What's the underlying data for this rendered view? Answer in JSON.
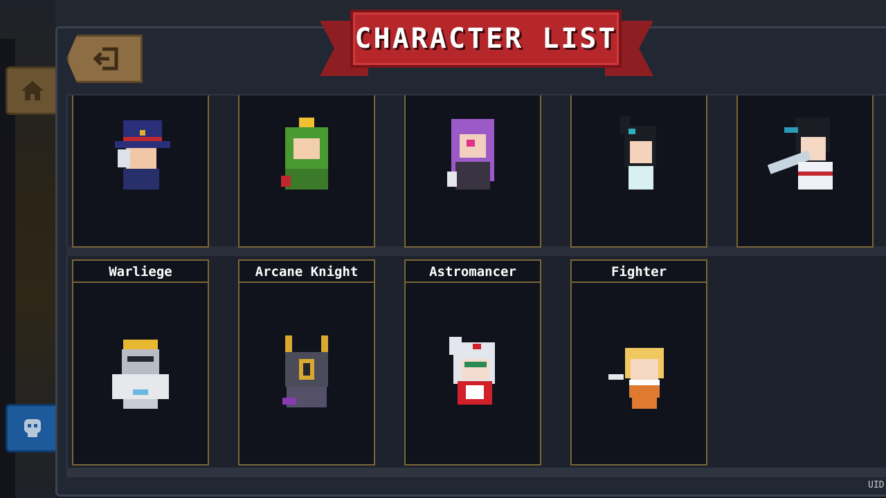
{
  "header": {
    "title": "CHARACTER LIST"
  },
  "footer": {
    "uid_label": "UID"
  },
  "characters_top": [
    {
      "portrait": "top-hat-gentleman-icon"
    },
    {
      "portrait": "frog-prince-icon"
    },
    {
      "portrait": "purple-hair-witch-icon"
    },
    {
      "portrait": "dark-hair-girl-icon"
    },
    {
      "portrait": "swordsman-icon"
    }
  ],
  "characters": [
    {
      "name": "Warliege",
      "portrait": "crowned-knight-icon"
    },
    {
      "name": "Arcane Knight",
      "portrait": "horned-knight-icon"
    },
    {
      "name": "Astromancer",
      "portrait": "white-hair-mage-icon"
    },
    {
      "name": "Fighter",
      "portrait": "blonde-fighter-icon"
    }
  ],
  "colors": {
    "ribbon": "#b5272b",
    "card_border": "#7a6636",
    "card_bg": "#10131c",
    "back_button": "#8c6d44"
  }
}
